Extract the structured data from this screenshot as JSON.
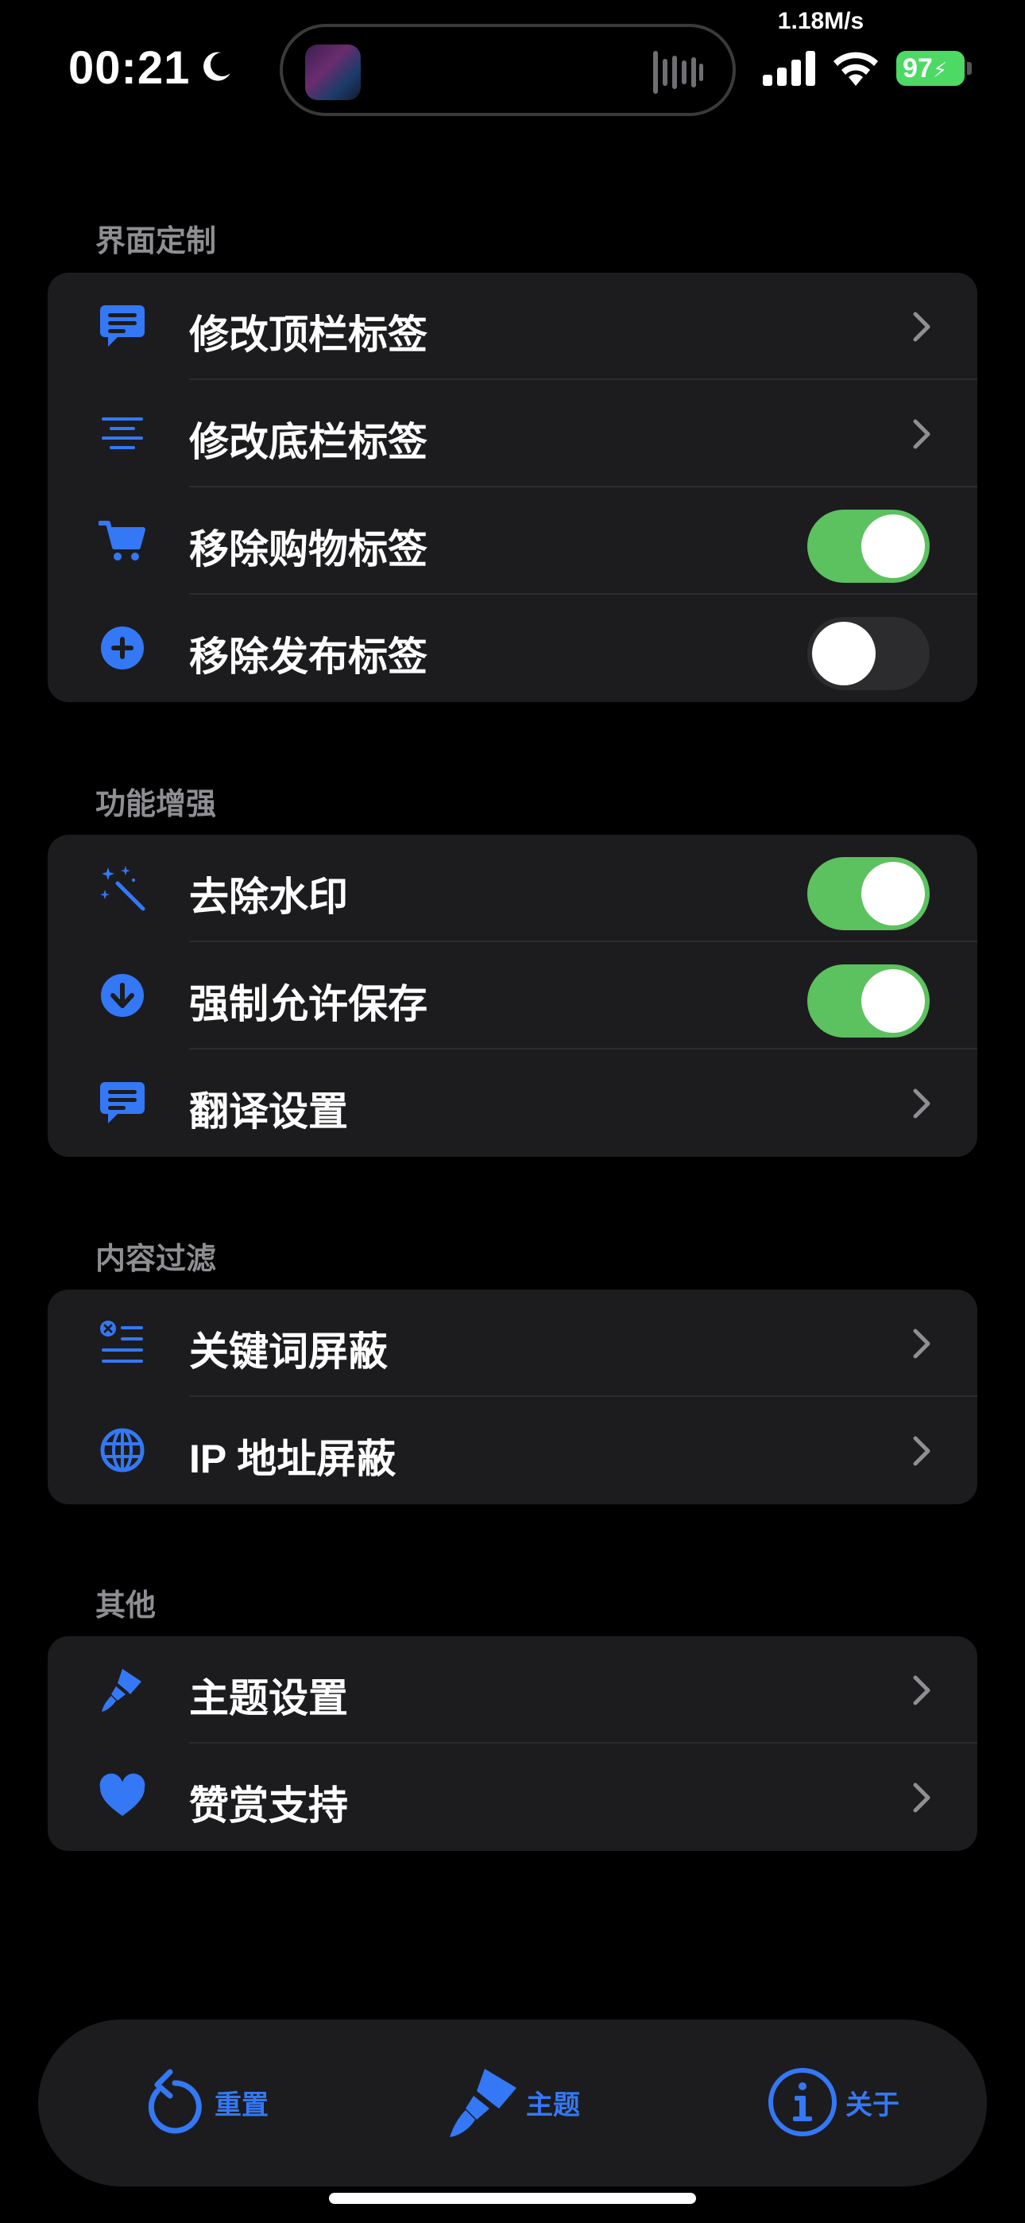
{
  "status_bar": {
    "time": "00:21",
    "network_speed": "1.18M/s",
    "battery_level": "97",
    "icons": [
      "moon-icon",
      "signal-icon",
      "wifi-icon",
      "battery-icon"
    ]
  },
  "accent_color": "#3478f6",
  "toggle_on_color": "#5cc15f",
  "sections": [
    {
      "header": "界面定制",
      "rows": [
        {
          "label": "修改顶栏标签",
          "icon": "message-icon",
          "control": "chevron"
        },
        {
          "label": "修改底栏标签",
          "icon": "align-center-icon",
          "control": "chevron"
        },
        {
          "label": "移除购物标签",
          "icon": "cart-icon",
          "control": "toggle",
          "on": true
        },
        {
          "label": "移除发布标签",
          "icon": "plus-circle-icon",
          "control": "toggle",
          "on": false
        }
      ]
    },
    {
      "header": "功能增强",
      "rows": [
        {
          "label": "去除水印",
          "icon": "magic-wand-icon",
          "control": "toggle",
          "on": true
        },
        {
          "label": "强制允许保存",
          "icon": "download-circle-icon",
          "control": "toggle",
          "on": true
        },
        {
          "label": "翻译设置",
          "icon": "message-icon",
          "control": "chevron"
        }
      ]
    },
    {
      "header": "内容过滤",
      "rows": [
        {
          "label": "关键词屏蔽",
          "icon": "list-remove-icon",
          "control": "chevron"
        },
        {
          "label": "IP 地址屏蔽",
          "icon": "globe-icon",
          "control": "chevron"
        }
      ]
    },
    {
      "header": "其他",
      "rows": [
        {
          "label": "主题设置",
          "icon": "paintbrush-icon",
          "control": "chevron"
        },
        {
          "label": "赞赏支持",
          "icon": "heart-icon",
          "control": "chevron"
        }
      ]
    }
  ],
  "tab_bar": {
    "items": [
      {
        "label": "重置",
        "icon": "reset-icon"
      },
      {
        "label": "主题",
        "icon": "paintbrush-icon"
      },
      {
        "label": "关于",
        "icon": "info-icon"
      }
    ]
  }
}
